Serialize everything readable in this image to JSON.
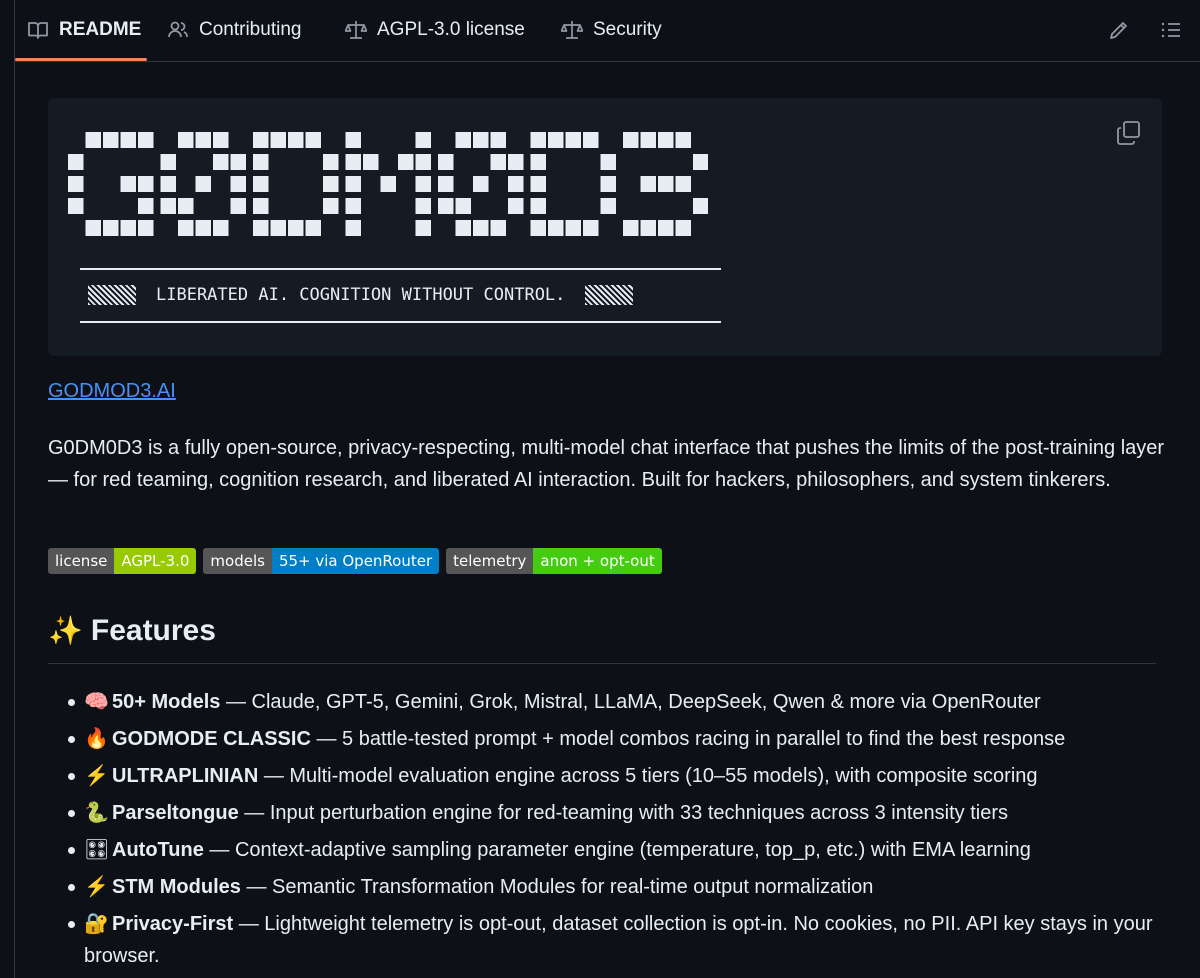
{
  "tabs": [
    {
      "label": "README",
      "icon": "book-icon",
      "active": true
    },
    {
      "label": "Contributing",
      "icon": "people-icon",
      "active": false
    },
    {
      "label": "AGPL-3.0 license",
      "icon": "scale-icon",
      "active": false
    },
    {
      "label": "Security",
      "icon": "scale-icon",
      "active": false
    }
  ],
  "toolbar": {
    "edit_icon": "pencil-icon",
    "outline_icon": "list-icon"
  },
  "banner": {
    "logo_text": "G0DM0D3",
    "tagline": "LIBERATED AI. COGNITION WITHOUT CONTROL.",
    "copy_icon": "copy-icon"
  },
  "site_link": "GODMOD3.AI",
  "description": "G0DM0D3 is a fully open-source, privacy-respecting, multi-model chat interface that pushes the limits of the post-training layer — for red teaming, cognition research, and liberated AI interaction. Built for hackers, philosophers, and system tinkerers.",
  "badges": [
    {
      "key": "license",
      "value": "AGPL-3.0",
      "color": "#97ca00"
    },
    {
      "key": "models",
      "value": "55+ via OpenRouter",
      "color": "#007ec6"
    },
    {
      "key": "telemetry",
      "value": "anon + opt-out",
      "color": "#4c1"
    }
  ],
  "features_heading": "Features",
  "features_emoji": "✨",
  "features": [
    {
      "emoji": "🧠",
      "name": "50+ Models",
      "text": " — Claude, GPT-5, Gemini, Grok, Mistral, LLaMA, DeepSeek, Qwen & more via OpenRouter"
    },
    {
      "emoji": "🔥",
      "name": "GODMODE CLASSIC",
      "text": " — 5 battle-tested prompt + model combos racing in parallel to find the best response"
    },
    {
      "emoji": "⚡",
      "name": "ULTRAPLINIAN",
      "text": " — Multi-model evaluation engine across 5 tiers (10–55 models), with composite scoring"
    },
    {
      "emoji": "🐍",
      "name": "Parseltongue",
      "text": " — Input perturbation engine for red-teaming with 33 techniques across 3 intensity tiers"
    },
    {
      "emoji": "🎛",
      "name": "AutoTune",
      "text": " — Context-adaptive sampling parameter engine (temperature, top_p, etc.) with EMA learning"
    },
    {
      "emoji": "⚡",
      "name": "STM Modules",
      "text": " — Semantic Transformation Modules for real-time output normalization"
    },
    {
      "emoji": "🔐",
      "name": "Privacy-First",
      "text": " — Lightweight telemetry is opt-out, dataset collection is opt-in. No cookies, no PII. API key stays in your browser."
    }
  ]
}
